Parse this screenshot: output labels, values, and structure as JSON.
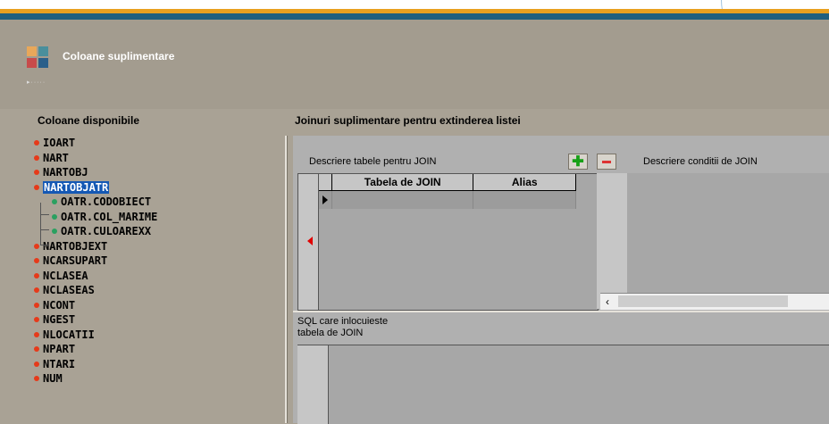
{
  "header": {
    "title": "Coloane suplimentare",
    "dots": "▸·····"
  },
  "left_panel": {
    "title": "Coloane disponibile",
    "items": [
      {
        "label": "IOART",
        "level": 0
      },
      {
        "label": "NART",
        "level": 0
      },
      {
        "label": "NARTOBJ",
        "level": 0
      },
      {
        "label": "NARTOBJATR",
        "level": 0,
        "selected": true
      },
      {
        "label": "OATR.CODOBIECT",
        "level": 1
      },
      {
        "label": "OATR.COL_MARIME",
        "level": 1
      },
      {
        "label": "OATR.CULOAREXX",
        "level": 1
      },
      {
        "label": "NARTOBJEXT",
        "level": 0
      },
      {
        "label": "NCARSUPART",
        "level": 0
      },
      {
        "label": "NCLASEA",
        "level": 0
      },
      {
        "label": "NCLASEAS",
        "level": 0
      },
      {
        "label": "NCONT",
        "level": 0
      },
      {
        "label": "NGEST",
        "level": 0
      },
      {
        "label": "NLOCATII",
        "level": 0
      },
      {
        "label": "NPART",
        "level": 0
      },
      {
        "label": "NTARI",
        "level": 0
      },
      {
        "label": "NUM",
        "level": 0
      }
    ]
  },
  "right_panel": {
    "title": "Joinuri suplimentare pentru extinderea listei",
    "tables_label": "Descriere tabele pentru JOIN",
    "conditions_label": "Descriere conditii de JOIN",
    "grid_columns": [
      "Tabela de JOIN",
      "Alias"
    ],
    "sql_label_line1": "SQL care inlocuieste",
    "sql_label_line2": "tabela de JOIN"
  },
  "icons": {
    "add": "plus-icon",
    "remove": "minus-icon"
  },
  "colors": {
    "selected": "#1458b4",
    "bullet_root": "#e63a1a",
    "bullet_child": "#2aa060",
    "accent_stripe": "#e8a020",
    "header_stripe": "#1f5f7f"
  }
}
